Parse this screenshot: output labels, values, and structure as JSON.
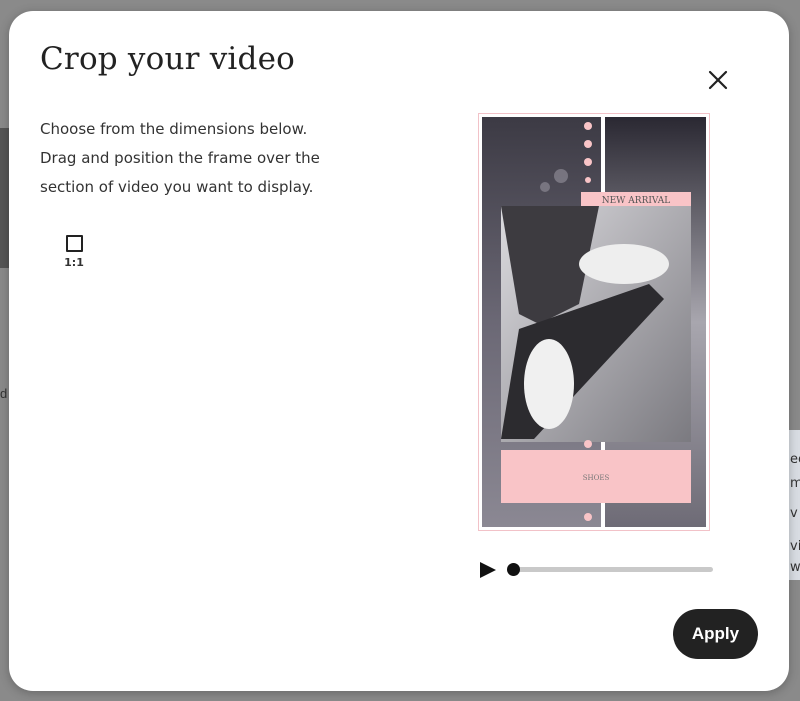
{
  "background": {
    "right_texts": [
      "ec",
      "m",
      "v",
      "vi",
      "w"
    ],
    "left_text": "d"
  },
  "modal": {
    "title": "Crop your video",
    "description_lines": [
      "Choose from the dimensions below.",
      "Drag and position the frame over the",
      "section of video you want to display."
    ],
    "close_icon": "close-icon",
    "ratio_option": {
      "label": "1:1",
      "icon": "square-icon",
      "selected": false
    },
    "preview": {
      "banner_text": "NEW ARRIVAL",
      "caption_text": "SHOES",
      "accent_color": "#f9c4c7"
    },
    "player": {
      "play_icon": "play-icon",
      "progress": 0.0
    },
    "apply_label": "Apply"
  }
}
